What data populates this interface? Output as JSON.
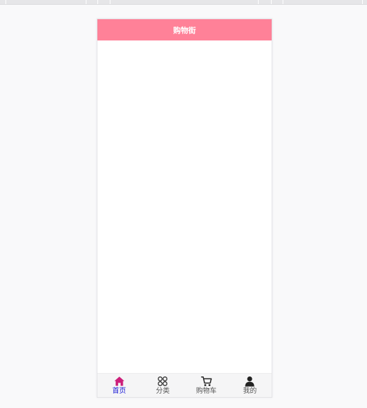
{
  "header": {
    "title": "购物街"
  },
  "tabbar": {
    "items": [
      {
        "label": "首页",
        "icon": "home-icon",
        "active": true
      },
      {
        "label": "分类",
        "icon": "category-grid-icon",
        "active": false
      },
      {
        "label": "购物车",
        "icon": "cart-icon",
        "active": false
      },
      {
        "label": "我的",
        "icon": "user-icon",
        "active": false
      }
    ]
  },
  "colors": {
    "header_bg": "#ff8198",
    "active_icon": "#cc1f7a",
    "active_label": "#1a1ad6",
    "inactive": "#333333"
  }
}
